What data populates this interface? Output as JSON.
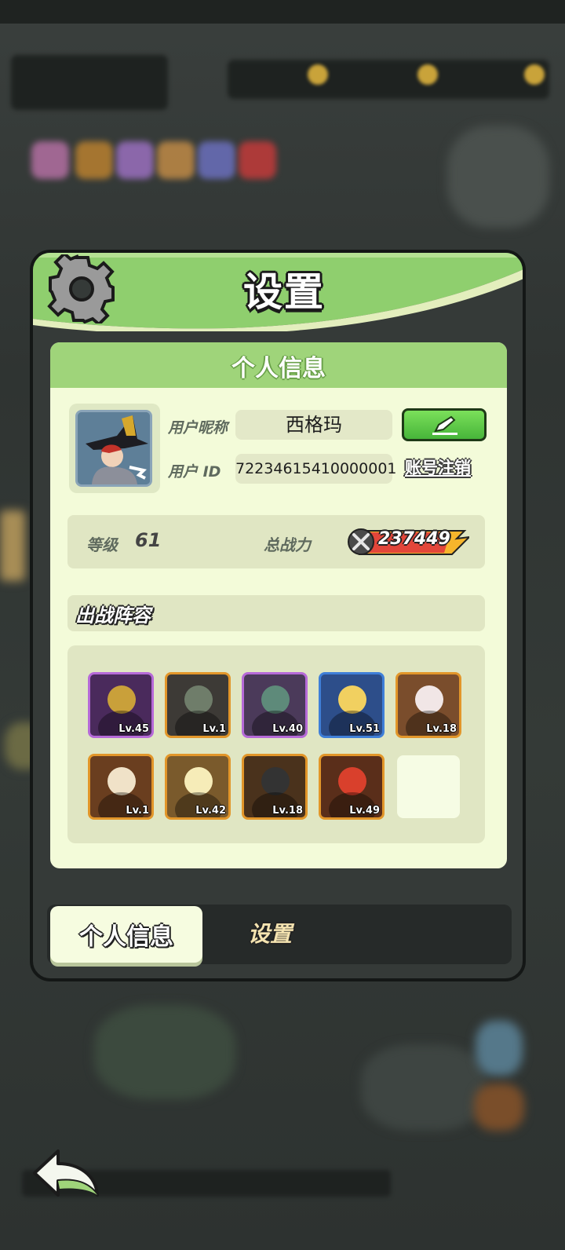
{
  "panel": {
    "title": "设置",
    "accent": "#9fd47a"
  },
  "profile": {
    "section_title": "个人信息",
    "nickname_label": "用户昵称",
    "nickname": "西格玛",
    "id_label": "用户 ID",
    "user_id": "72234615410000001",
    "logout_label": "账号注销",
    "level_label": "等级",
    "level": "61",
    "power_label": "总战力",
    "power": "237449"
  },
  "lineup": {
    "title": "出战阵容",
    "heroes": [
      {
        "level": "Lv.45",
        "frame": "#b66ad8",
        "bg": "#4a2a5c",
        "accent": "#c9a03a"
      },
      {
        "level": "Lv.1",
        "frame": "#e2962a",
        "bg": "#3d3a36",
        "accent": "#6f7d6a"
      },
      {
        "level": "Lv.40",
        "frame": "#b66ad8",
        "bg": "#4b3a5a",
        "accent": "#5e8a7a"
      },
      {
        "level": "Lv.51",
        "frame": "#3f7fd8",
        "bg": "#2d4e8a",
        "accent": "#f1d060"
      },
      {
        "level": "Lv.18",
        "frame": "#e2962a",
        "bg": "#7a4d2c",
        "accent": "#f1e6e6"
      },
      {
        "level": "Lv.1",
        "frame": "#e2962a",
        "bg": "#6a3e1f",
        "accent": "#f0e2c8"
      },
      {
        "level": "Lv.42",
        "frame": "#e2962a",
        "bg": "#7a5a2c",
        "accent": "#f6ecb8"
      },
      {
        "level": "Lv.18",
        "frame": "#e2962a",
        "bg": "#4a321c",
        "accent": "#333333"
      },
      {
        "level": "Lv.49",
        "frame": "#e2962a",
        "bg": "#5a2e1a",
        "accent": "#d9402c"
      }
    ]
  },
  "tabs": {
    "profile": "个人信息",
    "settings": "设置"
  },
  "icons": {
    "gear": "gear-icon",
    "edit": "pencil-icon",
    "power": "crossed-swords-icon",
    "back": "back-arrow-icon"
  }
}
